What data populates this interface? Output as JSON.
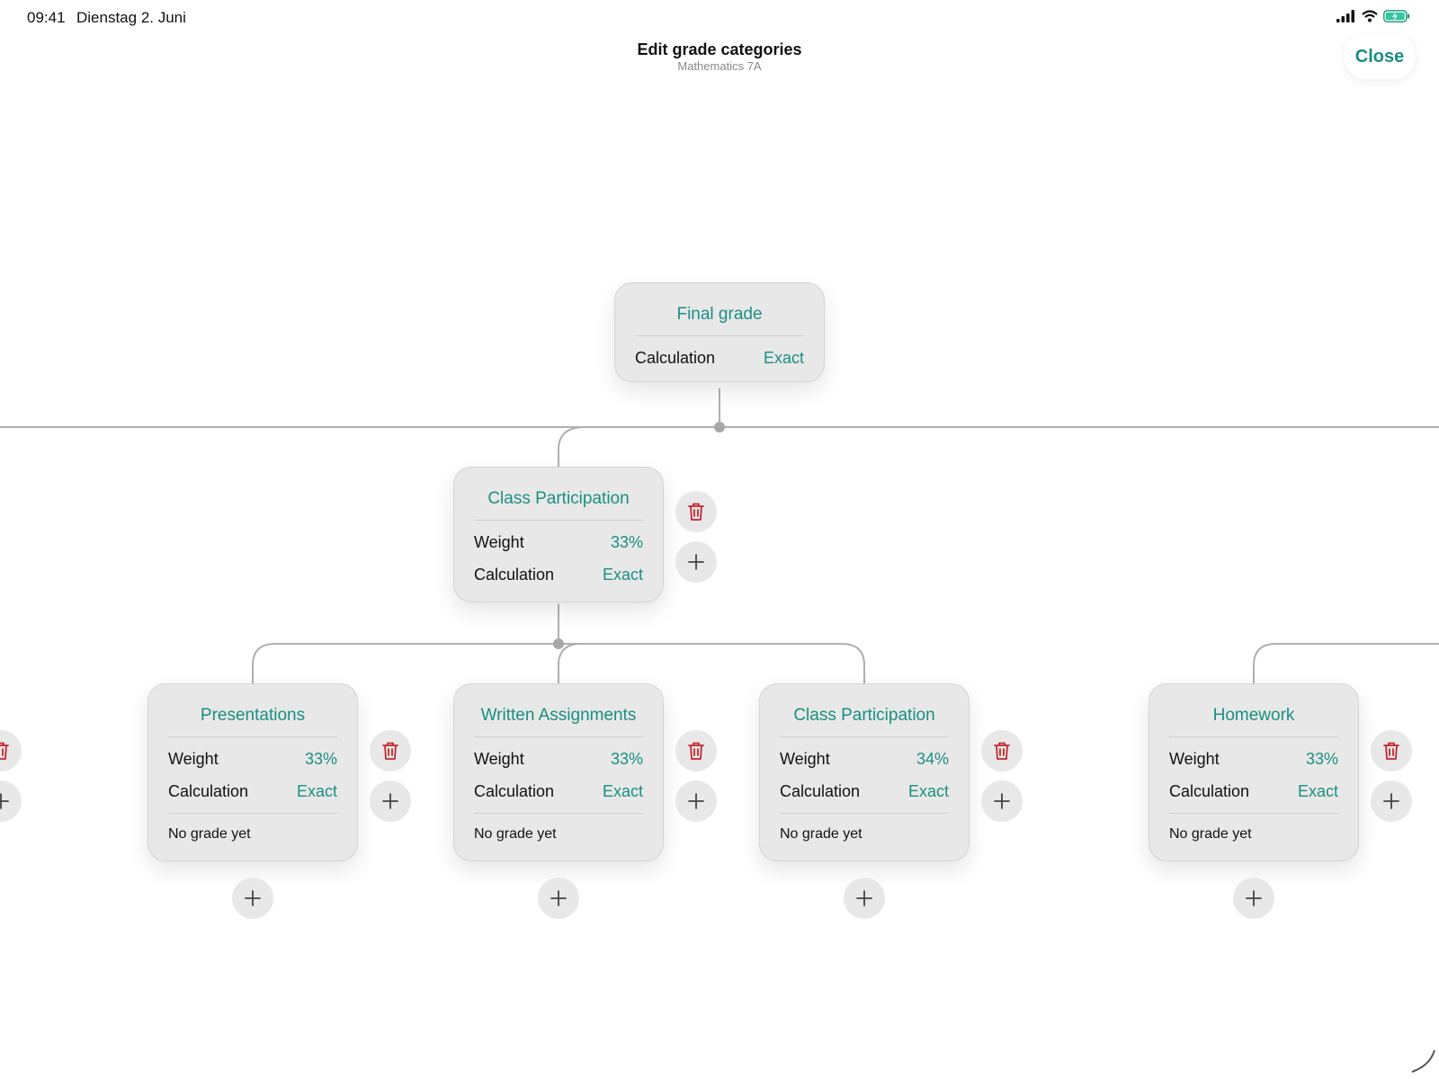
{
  "status_bar": {
    "time": "09:41",
    "date": "Dienstag 2. Juni"
  },
  "header": {
    "title": "Edit grade categories",
    "subtitle": "Mathematics 7A",
    "close_label": "Close"
  },
  "colors": {
    "accent": "#1a8f82",
    "delete": "#c4262e",
    "card_bg": "#e8e8e8",
    "line": "#b0b0b0"
  },
  "root": {
    "title": "Final grade",
    "calculation_label": "Calculation",
    "calculation_value": "Exact"
  },
  "level1": {
    "title": "Class Participation",
    "weight_label": "Weight",
    "weight_value": "33%",
    "calculation_label": "Calculation",
    "calculation_value": "Exact"
  },
  "level2": [
    {
      "title": "Presentations",
      "weight_label": "Weight",
      "weight_value": "33%",
      "calculation_label": "Calculation",
      "calculation_value": "Exact",
      "status": "No grade yet"
    },
    {
      "title": "Written Assignments",
      "weight_label": "Weight",
      "weight_value": "33%",
      "calculation_label": "Calculation",
      "calculation_value": "Exact",
      "status": "No grade yet"
    },
    {
      "title": "Class Participation",
      "weight_label": "Weight",
      "weight_value": "34%",
      "calculation_label": "Calculation",
      "calculation_value": "Exact",
      "status": "No grade yet"
    },
    {
      "title": "Homework",
      "weight_label": "Weight",
      "weight_value": "33%",
      "calculation_label": "Calculation",
      "calculation_value": "Exact",
      "status": "No grade yet"
    }
  ],
  "icons": {
    "delete": "trash-icon",
    "add": "plus-icon"
  }
}
